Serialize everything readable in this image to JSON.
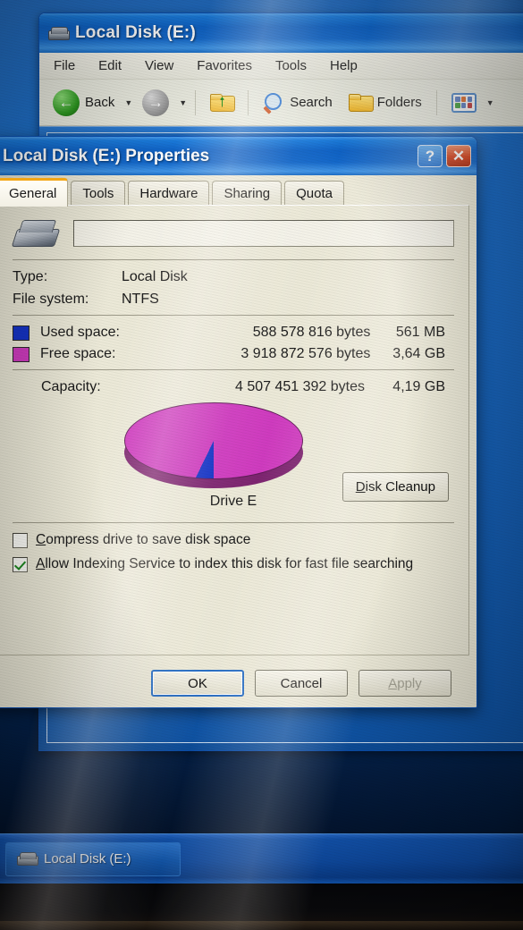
{
  "explorer": {
    "title": "Local Disk (E:)",
    "icon": "hard-drive-icon",
    "menu": [
      "File",
      "Edit",
      "View",
      "Favorites",
      "Tools",
      "Help"
    ],
    "toolbar": {
      "back_label": "Back",
      "search_label": "Search",
      "folders_label": "Folders"
    }
  },
  "dialog": {
    "title": "Local Disk (E:) Properties",
    "help_button": "?",
    "close_button": "✕",
    "tabs": [
      {
        "label": "General",
        "active": true
      },
      {
        "label": "Tools",
        "active": false
      },
      {
        "label": "Hardware",
        "active": false
      },
      {
        "label": "Sharing",
        "active": false
      },
      {
        "label": "Quota",
        "active": false
      }
    ],
    "volume_label_value": "",
    "volume_label_placeholder": "",
    "info": [
      {
        "label": "Type:",
        "value": "Local Disk"
      },
      {
        "label": "File system:",
        "value": "NTFS"
      }
    ],
    "usage": [
      {
        "name": "Used space:",
        "bytes": "588 578 816 bytes",
        "short": "561 MB",
        "color": "#1433c7"
      },
      {
        "name": "Free space:",
        "bytes": "3 918 872 576 bytes",
        "short": "3,64 GB",
        "color": "#cf3bbf"
      }
    ],
    "capacity": {
      "label": "Capacity:",
      "bytes": "4 507 451 392 bytes",
      "short": "4,19 GB"
    },
    "pie_label": "Drive E",
    "cleanup_button": {
      "accel": "D",
      "rest": "isk Cleanup"
    },
    "checkboxes": [
      {
        "accel": "C",
        "rest": "ompress drive to save disk space",
        "checked": false
      },
      {
        "accel": "A",
        "rest": "llow Indexing Service to index this disk for fast file searching",
        "checked": true
      }
    ],
    "buttons": {
      "ok": "OK",
      "cancel": "Cancel",
      "apply_accel": "A",
      "apply_rest": "pply"
    }
  },
  "taskbar": {
    "item_label": "Local Disk (E:)"
  },
  "chart_data": {
    "type": "pie",
    "title": "Drive E",
    "categories": [
      "Used space",
      "Free space"
    ],
    "values": [
      588578816,
      3918872576
    ],
    "value_labels": [
      "561 MB",
      "3,64 GB"
    ],
    "percentages": [
      13.1,
      86.9
    ],
    "colors": [
      "#1433c7",
      "#cf3bbf"
    ],
    "total": 4507451392,
    "total_label": "4,19 GB",
    "units": "bytes",
    "legend_position": "above",
    "style": "3d-pie"
  }
}
